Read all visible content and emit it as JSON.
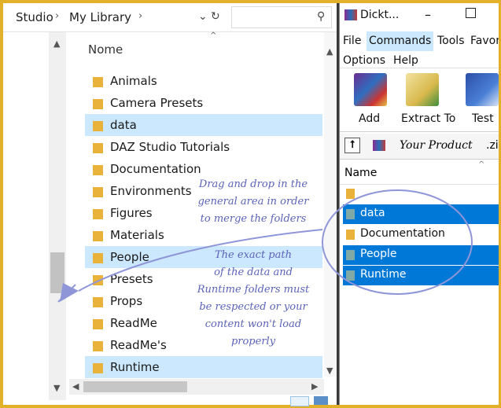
{
  "explorer": {
    "breadcrumb": [
      "Studio",
      "My Library"
    ],
    "column_header": "Nome",
    "folders": [
      {
        "name": "Animals",
        "selected": false
      },
      {
        "name": "Camera Presets",
        "selected": false
      },
      {
        "name": "data",
        "selected": true
      },
      {
        "name": "DAZ Studio Tutorials",
        "selected": false
      },
      {
        "name": "Documentation",
        "selected": false
      },
      {
        "name": "Environments",
        "selected": false
      },
      {
        "name": "Figures",
        "selected": false
      },
      {
        "name": "Materials",
        "selected": false
      },
      {
        "name": "People",
        "selected": true
      },
      {
        "name": "Presets",
        "selected": false
      },
      {
        "name": "Props",
        "selected": false
      },
      {
        "name": "ReadMe",
        "selected": false
      },
      {
        "name": "ReadMe's",
        "selected": false
      },
      {
        "name": "Runtime",
        "selected": true
      }
    ]
  },
  "winrar": {
    "title": "Dickt...",
    "menu": [
      "File",
      "Commands",
      "Tools",
      "Favor",
      "Options",
      "Help"
    ],
    "toolbar": [
      "Add",
      "Extract To",
      "Test"
    ],
    "path": "Your Product",
    "path_ext": ".zi",
    "column_header": "Name",
    "files": [
      {
        "name": "",
        "selected": false
      },
      {
        "name": "data",
        "selected": true
      },
      {
        "name": "Documentation",
        "selected": false
      },
      {
        "name": "People",
        "selected": true
      },
      {
        "name": "Runtime",
        "selected": true
      }
    ]
  },
  "annotations": {
    "note1": [
      "Drag and drop in the",
      "general area in order",
      "to merge the folders"
    ],
    "note2": [
      "The exact path",
      "of the data and",
      "Runtime folders must",
      "be respected or your",
      "content won't load",
      "properly"
    ]
  },
  "colors": {
    "frame": "#e3b02a",
    "selection": "#cce8ff",
    "winrar_selection": "#0078d7",
    "folder": "#e9b23a",
    "annotation": "#5b63b8"
  }
}
